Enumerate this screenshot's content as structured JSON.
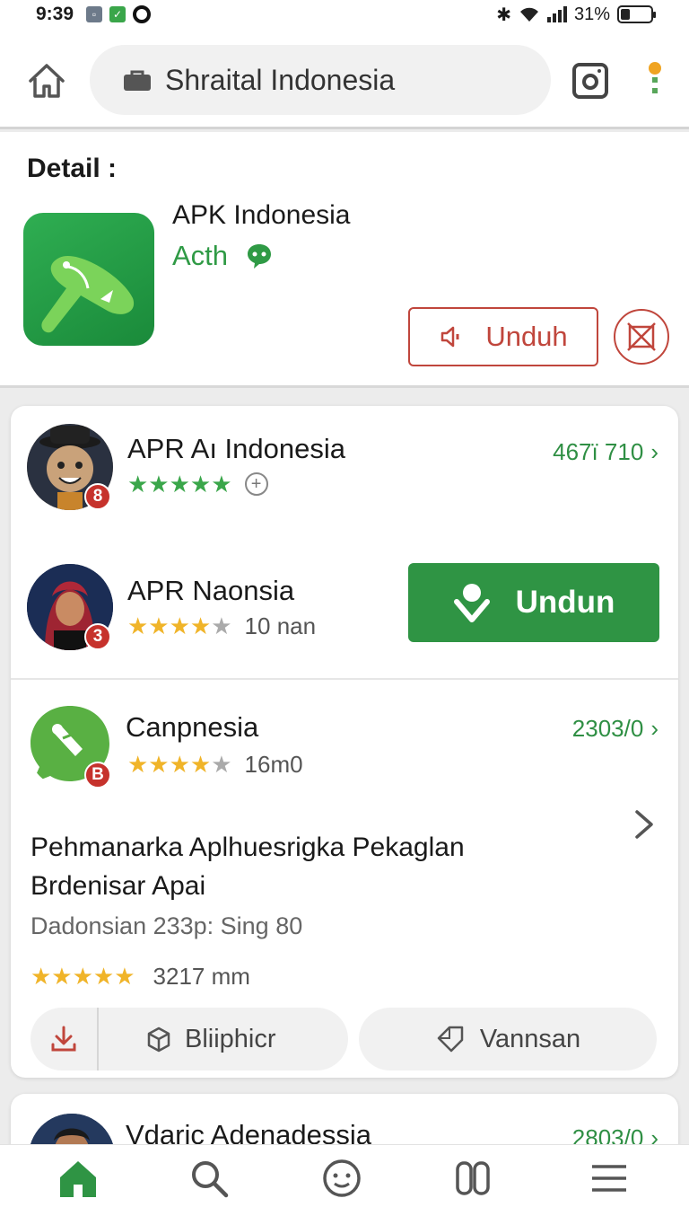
{
  "status_bar": {
    "time": "9:39",
    "battery": "31%",
    "battery_level": 0.31,
    "icons": [
      "notification-box-icon",
      "app-notification-icon",
      "circle-logo-icon",
      "bluetooth-icon",
      "wifi-icon",
      "signal-icon",
      "battery-icon"
    ]
  },
  "browser": {
    "url_text": "Shraital Indonesia",
    "icons": [
      "home-icon",
      "lock-icon",
      "camera-icon",
      "menu-dot-icon"
    ]
  },
  "detail": {
    "heading": "Detail :",
    "app_name": "APK Indonesia",
    "developer": "Acth",
    "download_label": "Unduh",
    "icons": [
      "app-logo-icon",
      "chat-bubble-icon",
      "speaker-icon",
      "block-icon"
    ]
  },
  "list": {
    "items": [
      {
        "title": "APR Aı Indonesia",
        "badge": "8",
        "rating_meta": "",
        "rating": 5,
        "count": "467ї 710"
      },
      {
        "title": "APR Naonsia",
        "badge": "3",
        "rating": 4.5,
        "rating_meta": "10 nan",
        "button_label": "Undun"
      },
      {
        "title": "Canpnesia",
        "badge": "B",
        "rating": 4.5,
        "rating_meta": "16m0",
        "count": "2303/0"
      }
    ],
    "description": {
      "title": "Pehmanarka Aplhuesrigka Pekaglan Brdenisar Apai",
      "subtitle": "Dadonsian 233p: Sing 80",
      "rating": 5,
      "rating_meta": "3217 mm"
    },
    "actions": {
      "primary_label": "Bliiphicr",
      "secondary_label": "Vannsan"
    },
    "next_item": {
      "title": "Vdaric Adenadessia",
      "count": "2803/0"
    }
  },
  "bottom_nav": [
    "home-icon",
    "search-icon",
    "smiley-icon",
    "book-icon",
    "menu-icon"
  ],
  "colors": {
    "brand_green": "#2f9444",
    "accent_red": "#c0463c",
    "star_green": "#3aa64a",
    "star_gold": "#f0b429"
  }
}
